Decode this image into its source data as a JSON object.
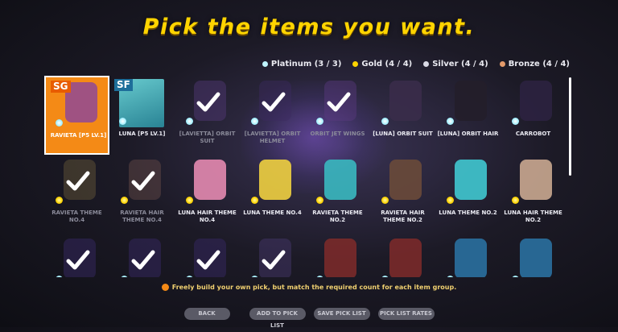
{
  "title": "Pick the items you want.",
  "counters": [
    {
      "label": "Platinum (3 / 3)",
      "color": "#bff4ff"
    },
    {
      "label": "Gold (4 / 4)",
      "color": "#ffd400"
    },
    {
      "label": "Silver (4 / 4)",
      "color": "#d9d9e6"
    },
    {
      "label": "Bronze (4 / 4)",
      "color": "#e49a6a"
    }
  ],
  "items": [
    {
      "label": "RAVIETA [P5 LV.1]",
      "badge": "SG",
      "state": "selected-orange",
      "tier": "platinum"
    },
    {
      "label": "LUNA [P5 LV.1]",
      "badge": "SF",
      "state": "selected-teal",
      "tier": "platinum"
    },
    {
      "label": "[LAVIETTA] ORBIT SUIT",
      "state": "checked",
      "tier": "platinum"
    },
    {
      "label": "[LAVIETTA] ORBIT HELMET",
      "state": "checked",
      "tier": "platinum"
    },
    {
      "label": "ORBIT JET WINGS",
      "state": "checked",
      "tier": "platinum"
    },
    {
      "label": "[LUNA] ORBIT SUIT",
      "state": "normal",
      "tier": "platinum"
    },
    {
      "label": "[LUNA] ORBIT HAIR",
      "state": "normal",
      "tier": "platinum"
    },
    {
      "label": "CARROBOT",
      "state": "normal",
      "tier": "platinum"
    },
    {
      "label": "RAVIETA THEME NO.4",
      "state": "checked",
      "tier": "gold"
    },
    {
      "label": "RAVIETA HAIR THEME NO.4",
      "state": "checked",
      "tier": "gold"
    },
    {
      "label": "LUNA HAIR THEME NO.4",
      "state": "normal",
      "tier": "gold"
    },
    {
      "label": "LUNA THEME NO.4",
      "state": "normal",
      "tier": "gold"
    },
    {
      "label": "RAVIETA THEME NO.2",
      "state": "normal",
      "tier": "gold"
    },
    {
      "label": "RAVIETA HAIR THEME NO.2",
      "state": "normal",
      "tier": "gold"
    },
    {
      "label": "LUNA THEME NO.2",
      "state": "normal",
      "tier": "gold"
    },
    {
      "label": "LUNA HAIR THEME NO.2",
      "state": "normal",
      "tier": "gold"
    },
    {
      "label": "",
      "state": "checked",
      "tier": "silver"
    },
    {
      "label": "",
      "state": "checked",
      "tier": "silver"
    },
    {
      "label": "",
      "state": "checked",
      "tier": "silver"
    },
    {
      "label": "",
      "state": "checked",
      "tier": "silver"
    },
    {
      "label": "",
      "state": "normal",
      "tier": "silver"
    },
    {
      "label": "",
      "state": "normal",
      "tier": "silver"
    },
    {
      "label": "",
      "state": "normal",
      "tier": "silver"
    },
    {
      "label": "",
      "state": "normal",
      "tier": "silver"
    }
  ],
  "hint": "Freely build your own pick, but match the required count for each item group.",
  "buttons": {
    "back": "BACK",
    "add": "ADD TO PICK LIST",
    "save": "SAVE PICK LIST",
    "rates": "PICK LIST RATES"
  },
  "art_colors": [
    "#3a2a3a",
    "#4a2f6a",
    "#553a7a",
    "#3b2a60",
    "#5a3a80",
    "#3a2c4a",
    "#241e2a",
    "#2c2240",
    "#6a5a3a",
    "#6a4e4a",
    "#e48ab0",
    "#f0d040",
    "#3ab8c0",
    "#6a4a3a",
    "#40c8d0",
    "#caa890",
    "#3a2a6a",
    "#3a2a6a",
    "#3a2a6a",
    "#4a3a70",
    "#7a2a2a",
    "#7a2a2a",
    "#2a70a0",
    "#2a70a0"
  ]
}
